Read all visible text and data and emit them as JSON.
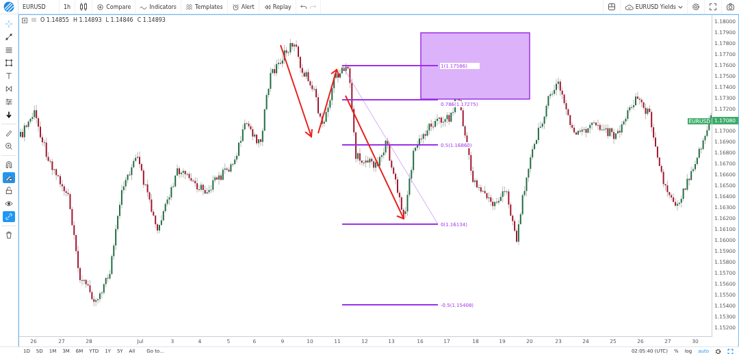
{
  "toolbar": {
    "symbol": "EURUSD",
    "interval": "1h",
    "buttons": [
      {
        "label": "Compare"
      },
      {
        "label": "Indicators"
      },
      {
        "label": "Templates"
      },
      {
        "label": "Alert"
      },
      {
        "label": "Replay"
      }
    ],
    "undo_disabled": false,
    "redo_disabled": true,
    "layout_name": "EURUSD Yields"
  },
  "legend": [
    {
      "key": "O",
      "value": "1.14855"
    },
    {
      "key": "H",
      "value": "1.14893"
    },
    {
      "key": "L",
      "value": "1.14846"
    },
    {
      "key": "C",
      "value": "1.14893"
    }
  ],
  "drawing_tools": [
    {
      "selected": false
    },
    {
      "selected": false
    },
    {
      "selected": false
    },
    {
      "selected": false
    },
    {
      "selected": false
    },
    {
      "selected": false
    },
    {
      "selected": false
    },
    {
      "selected": false
    },
    {
      "selected": false
    },
    {
      "selected": false
    },
    {
      "selected": false
    },
    {
      "selected": true
    },
    {
      "selected": false
    },
    {
      "selected": false
    },
    {
      "selected": true
    },
    {
      "selected": false
    }
  ],
  "fib_levels": [
    {
      "label": "1(1.17586)"
    },
    {
      "label": "0.786(1.17275)"
    },
    {
      "label": "0.5(1.16860)"
    },
    {
      "label": "0(1.16134)"
    },
    {
      "label": "-0.5(1.15408)"
    }
  ],
  "price_axis": {
    "labels": [
      {
        "kind": "tick",
        "text": "1.18000"
      },
      {
        "kind": "tick",
        "text": "1.17900"
      },
      {
        "kind": "tick",
        "text": "1.17800"
      },
      {
        "kind": "tick",
        "text": "1.17700"
      },
      {
        "kind": "tick",
        "text": "1.17600"
      },
      {
        "kind": "tick",
        "text": "1.17500"
      },
      {
        "kind": "tick",
        "text": "1.17400"
      },
      {
        "kind": "tick",
        "text": "1.17300"
      },
      {
        "kind": "tick",
        "text": "1.17200"
      },
      {
        "kind": "last_price",
        "text": "1.17080"
      },
      {
        "kind": "tick",
        "text": "1.17000"
      }
    ],
    "labels_lower": [
      "1.16900",
      "1.16800",
      "1.16700",
      "1.16600",
      "1.16500",
      "1.16400",
      "1.16300",
      "1.16200",
      "1.16100",
      "1.16000",
      "1.15900",
      "1.15800",
      "1.15700",
      "1.15600",
      "1.15500",
      "1.15400",
      "1.15300",
      "1.15200"
    ],
    "symbol_tag": "EURUSD"
  },
  "time_axis": [
    "26",
    "27",
    "28",
    "Jul",
    "3",
    "4",
    "5",
    "6",
    "9",
    "10",
    "11",
    "12",
    "13",
    "16",
    "17",
    "18",
    "19",
    "20",
    "23",
    "24",
    "25",
    "26",
    "27",
    "30"
  ],
  "bottom_bar": {
    "ranges": [
      "1D",
      "5D",
      "1M",
      "3M",
      "6M",
      "YTD",
      "1Y",
      "5Y",
      "All"
    ],
    "goto": "Go to...",
    "clock": "02:05:40 (UTC)",
    "scale_modes": [
      {
        "label": "%",
        "selected": false
      },
      {
        "label": "log",
        "selected": false
      },
      {
        "label": "auto",
        "selected": true
      }
    ]
  }
}
